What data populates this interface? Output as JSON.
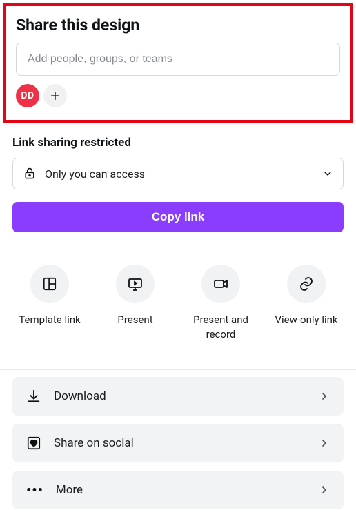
{
  "share": {
    "title": "Share this design",
    "input_placeholder": "Add people, groups, or teams",
    "avatar_initials": "DD"
  },
  "link": {
    "label": "Link sharing restricted",
    "access_text": "Only you can access",
    "copy_button": "Copy link"
  },
  "options": [
    {
      "label": "Template link"
    },
    {
      "label": "Present"
    },
    {
      "label": "Present and record"
    },
    {
      "label": "View-only link"
    }
  ],
  "actions": {
    "download": "Download",
    "share_social": "Share on social",
    "more": "More"
  }
}
